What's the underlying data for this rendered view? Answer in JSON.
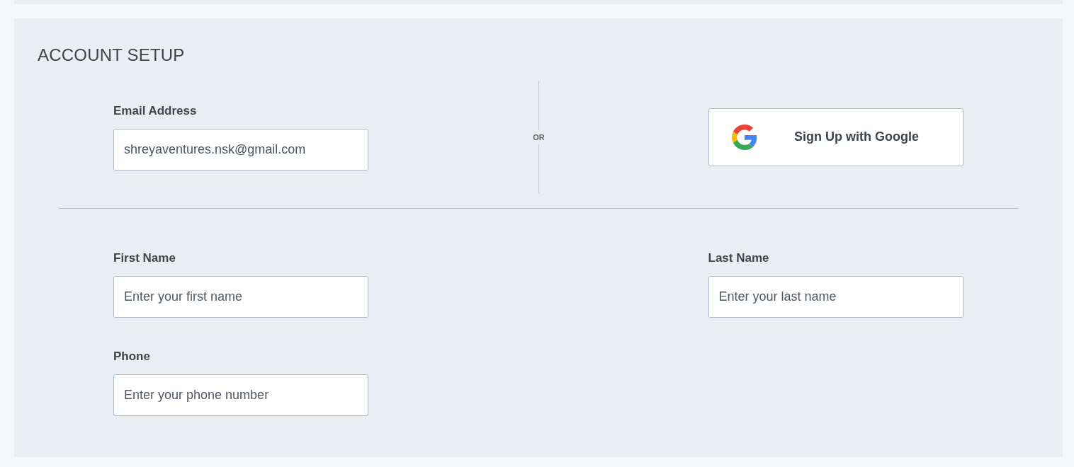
{
  "section": {
    "title": "ACCOUNT SETUP"
  },
  "email": {
    "label": "Email Address",
    "value": "shreyaventures.nsk@gmail.com"
  },
  "divider": {
    "label": "OR"
  },
  "google_button": {
    "label": "Sign Up with Google"
  },
  "fields": [
    {
      "label": "First Name",
      "placeholder": "Enter your first name"
    },
    {
      "label": "Last Name",
      "placeholder": "Enter your last name"
    },
    {
      "label": "Phone",
      "placeholder": "Enter your phone number"
    }
  ]
}
